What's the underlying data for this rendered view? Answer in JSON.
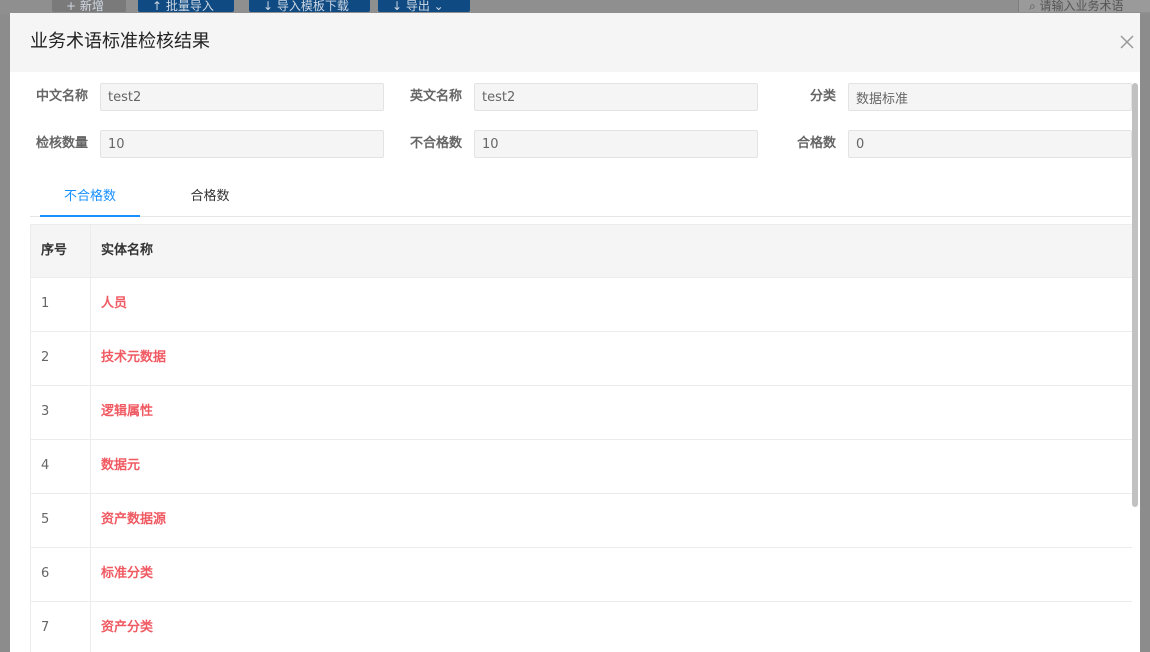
{
  "background": {
    "buttons": {
      "add": "+ 新增",
      "batch_import": "↑ 批量导入",
      "template_download": "↓ 导入模板下载",
      "export": "↓ 导出 ⌄"
    },
    "search_placeholder": "请输入业务术语"
  },
  "modal": {
    "title": "业务术语标准检核结果",
    "fields": {
      "chinese_name": {
        "label": "中文名称",
        "value": "test2"
      },
      "english_name": {
        "label": "英文名称",
        "value": "test2"
      },
      "category": {
        "label": "分类",
        "value": "数据标准"
      },
      "check_count": {
        "label": "检核数量",
        "value": "10"
      },
      "fail_count": {
        "label": "不合格数",
        "value": "10"
      },
      "pass_count": {
        "label": "合格数",
        "value": "0"
      }
    },
    "tabs": [
      {
        "label": "不合格数",
        "active": true
      },
      {
        "label": "合格数",
        "active": false
      }
    ],
    "table": {
      "columns": [
        "序号",
        "实体名称"
      ],
      "rows": [
        {
          "index": "1",
          "name": "人员"
        },
        {
          "index": "2",
          "name": "技术元数据"
        },
        {
          "index": "3",
          "name": "逻辑属性"
        },
        {
          "index": "4",
          "name": "数据元"
        },
        {
          "index": "5",
          "name": "资产数据源"
        },
        {
          "index": "6",
          "name": "标准分类"
        },
        {
          "index": "7",
          "name": "资产分类"
        }
      ]
    }
  },
  "colors": {
    "accent": "#1890ff",
    "fail_text": "#f05a63"
  }
}
